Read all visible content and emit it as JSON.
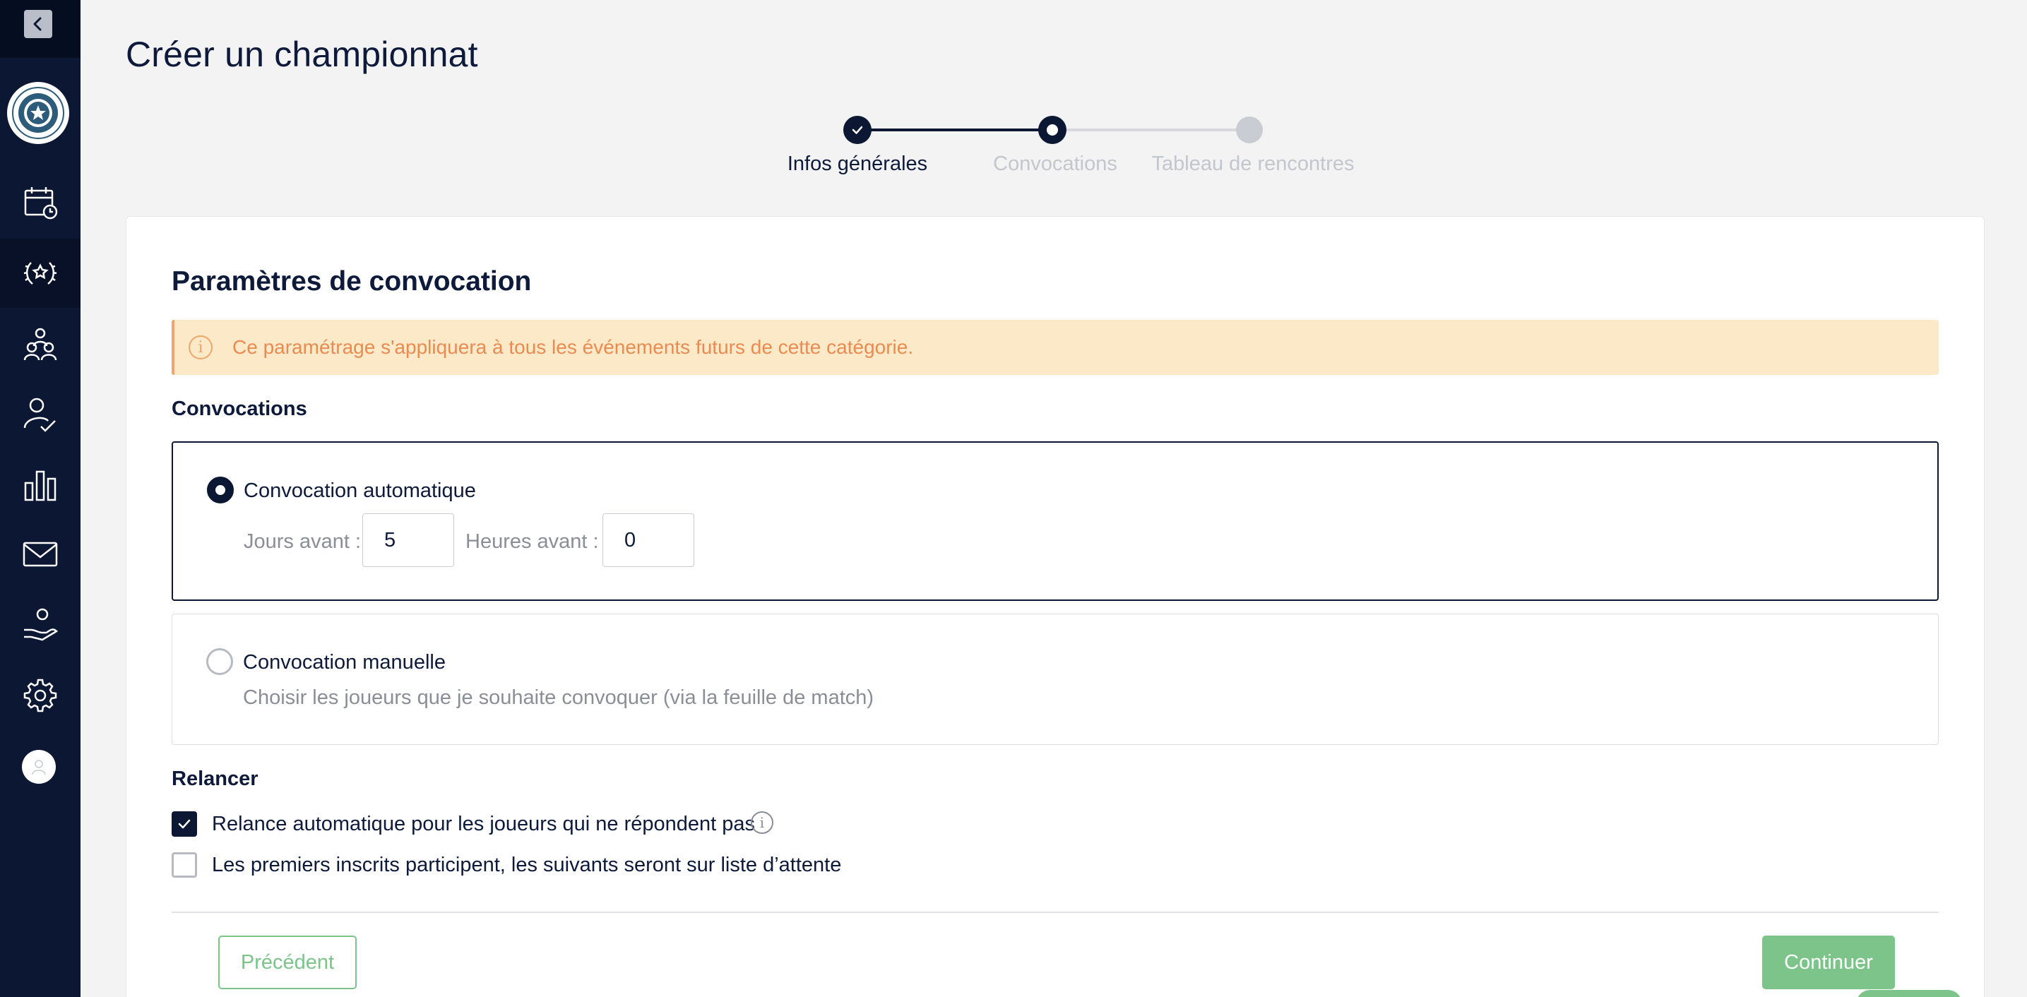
{
  "page": {
    "title": "Créer un championnat"
  },
  "stepper": {
    "steps": [
      {
        "label": "Infos générales",
        "state": "done"
      },
      {
        "label": "Convocations",
        "state": "current"
      },
      {
        "label": "Tableau de rencontres",
        "state": "upcoming"
      }
    ]
  },
  "sidebar": {
    "items": [
      {
        "icon": "calendar-clock-icon"
      },
      {
        "icon": "laurel-trophy-icon",
        "active": true
      },
      {
        "icon": "team-icon"
      },
      {
        "icon": "user-check-icon"
      },
      {
        "icon": "bar-chart-icon"
      },
      {
        "icon": "mail-icon"
      },
      {
        "icon": "hand-heart-icon"
      },
      {
        "icon": "gear-icon"
      }
    ]
  },
  "section": {
    "title": "Paramètres de convocation",
    "alert": "Ce paramétrage s'appliquera à tous les événements futurs de cette catégorie."
  },
  "convocations": {
    "heading": "Convocations",
    "auto": {
      "label": "Convocation automatique",
      "selected": true,
      "days_label": "Jours avant :",
      "days_value": "5",
      "hours_label": "Heures avant :",
      "hours_value": "0"
    },
    "manual": {
      "label": "Convocation manuelle",
      "selected": false,
      "description": "Choisir les joueurs que je souhaite convoquer (via la feuille de match)"
    }
  },
  "relancer": {
    "heading": "Relancer",
    "options": [
      {
        "label": "Relance automatique pour les joueurs qui ne répondent pas",
        "checked": true
      },
      {
        "label": "Les premiers inscrits participent, les suivants seront sur liste d’attente",
        "checked": false
      }
    ]
  },
  "actions": {
    "prev_label": "Précédent",
    "next_label": "Continuer"
  },
  "colors": {
    "navy": "#0b1733",
    "green": "#7cc48a",
    "alert_bg": "#fbe9c8",
    "alert_text": "#ea8b52"
  }
}
